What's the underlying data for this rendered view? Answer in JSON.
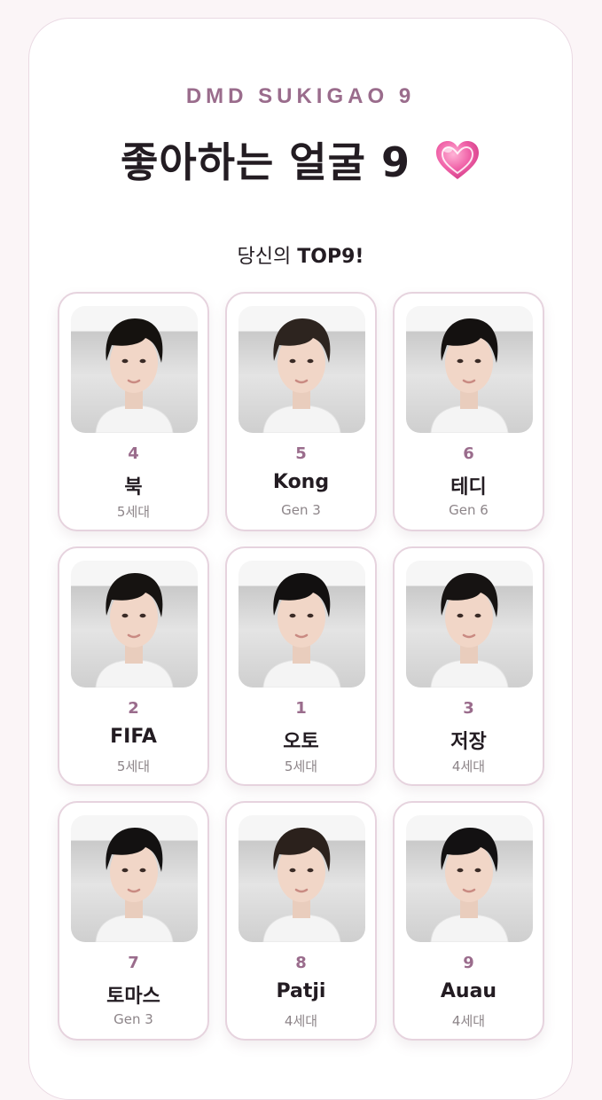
{
  "header": {
    "brand": "DMD SUKIGAO 9",
    "title": "좋아하는 얼굴 9",
    "subtitle_prefix": "당신의 ",
    "subtitle_bold": "TOP9!"
  },
  "colors": {
    "accent": "#9a6c8c",
    "heart": "#e8559a",
    "tile_border": "#e6d3de"
  },
  "cards": [
    {
      "rank": "4",
      "name": "북",
      "gen": "5세대",
      "hair": "#15120f"
    },
    {
      "rank": "5",
      "name": "Kong",
      "gen": "Gen 3",
      "hair": "#2d241f"
    },
    {
      "rank": "6",
      "name": "테디",
      "gen": "Gen 6",
      "hair": "#141110"
    },
    {
      "rank": "2",
      "name": "FIFA",
      "gen": "5세대",
      "hair": "#161311"
    },
    {
      "rank": "1",
      "name": "오토",
      "gen": "5세대",
      "hair": "#121010"
    },
    {
      "rank": "3",
      "name": "저장",
      "gen": "4세대",
      "hair": "#161312"
    },
    {
      "rank": "7",
      "name": "토마스",
      "gen": "Gen 3",
      "hair": "#131111"
    },
    {
      "rank": "8",
      "name": "Patji",
      "gen": "4세대",
      "hair": "#2b211c"
    },
    {
      "rank": "9",
      "name": "Auau",
      "gen": "4세대",
      "hair": "#131112"
    }
  ]
}
